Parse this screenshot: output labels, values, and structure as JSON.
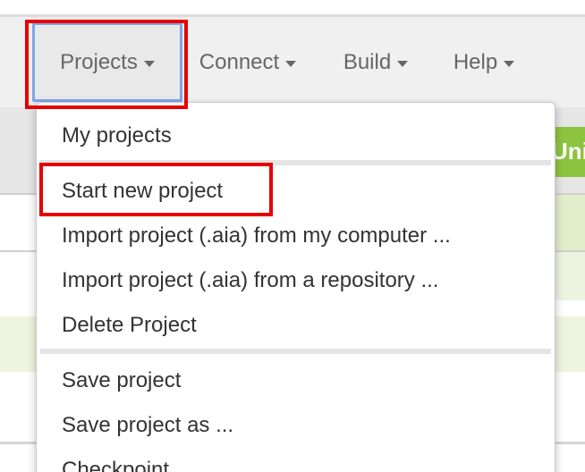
{
  "nav": {
    "projects": "Projects",
    "connect": "Connect",
    "build": "Build",
    "help": "Help"
  },
  "background": {
    "green_tab_text": "Uni"
  },
  "menu": {
    "my_projects": "My projects",
    "start_new_project": "Start new project",
    "import_computer": "Import project (.aia) from my computer ...",
    "import_repository": "Import project (.aia) from a repository ...",
    "delete_project": "Delete Project",
    "save_project": "Save project",
    "save_project_as": "Save project as ...",
    "checkpoint": "Checkpoint"
  },
  "colors": {
    "highlight": "#e60000",
    "accent_green": "#8cc43f",
    "focus_blue": "#7da6e8"
  }
}
